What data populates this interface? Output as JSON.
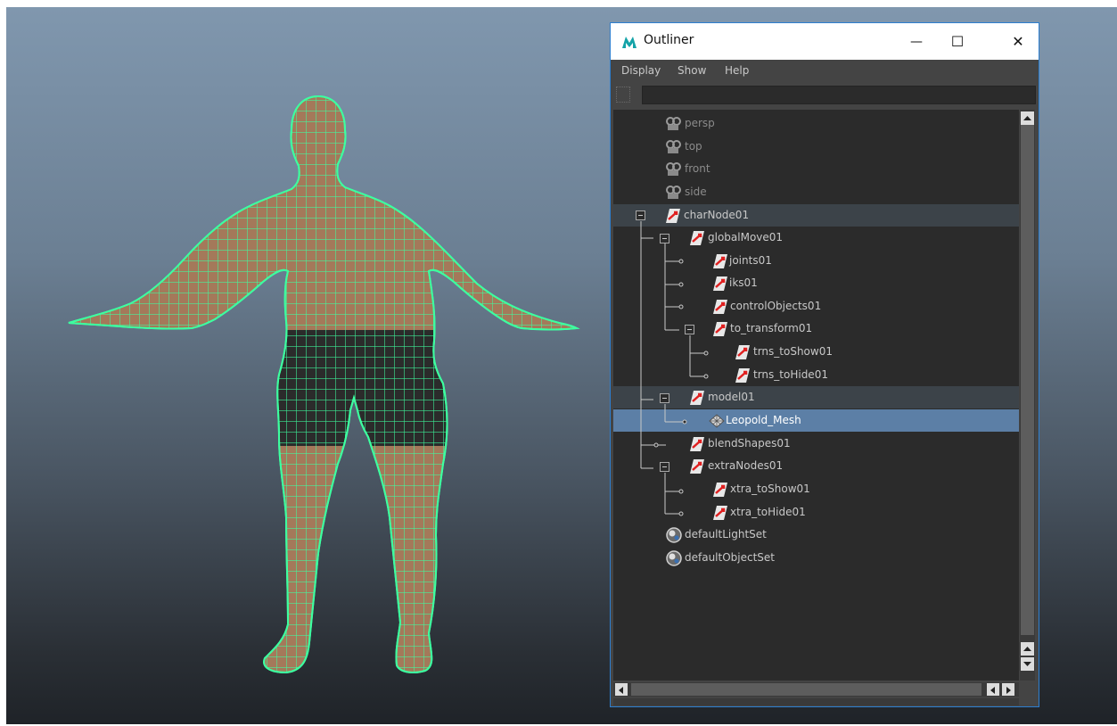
{
  "window": {
    "title": "Outliner",
    "minimize_glyph": "—",
    "maximize_glyph": "☐",
    "close_glyph": "✕"
  },
  "menu": {
    "display": "Display",
    "show": "Show",
    "help": "Help"
  },
  "filter": {
    "value": ""
  },
  "tree": {
    "nodes": [
      {
        "label": "persp",
        "icon": "camera-icon"
      },
      {
        "label": "top",
        "icon": "camera-icon"
      },
      {
        "label": "front",
        "icon": "camera-icon"
      },
      {
        "label": "side",
        "icon": "camera-icon"
      },
      {
        "label": "charNode01",
        "icon": "transform-icon"
      },
      {
        "label": "globalMove01",
        "icon": "transform-icon"
      },
      {
        "label": "joints01",
        "icon": "transform-icon"
      },
      {
        "label": "iks01",
        "icon": "transform-icon"
      },
      {
        "label": "controlObjects01",
        "icon": "transform-icon"
      },
      {
        "label": "to_transform01",
        "icon": "transform-icon"
      },
      {
        "label": "trns_toShow01",
        "icon": "transform-icon"
      },
      {
        "label": "trns_toHide01",
        "icon": "transform-icon"
      },
      {
        "label": "model01",
        "icon": "transform-icon"
      },
      {
        "label": "Leopold_Mesh",
        "icon": "mesh-icon"
      },
      {
        "label": "blendShapes01",
        "icon": "transform-icon"
      },
      {
        "label": "extraNodes01",
        "icon": "transform-icon"
      },
      {
        "label": "xtra_toShow01",
        "icon": "transform-icon"
      },
      {
        "label": "xtra_toHide01",
        "icon": "transform-icon"
      },
      {
        "label": "defaultLightSet",
        "icon": "set-icon"
      },
      {
        "label": "defaultObjectSet",
        "icon": "set-icon"
      }
    ]
  },
  "colors": {
    "wireframe": "#3dffa0",
    "selected_row": "#5c7fa6",
    "highlight_row": "#3c4349",
    "window_border": "#2d7fd0"
  }
}
